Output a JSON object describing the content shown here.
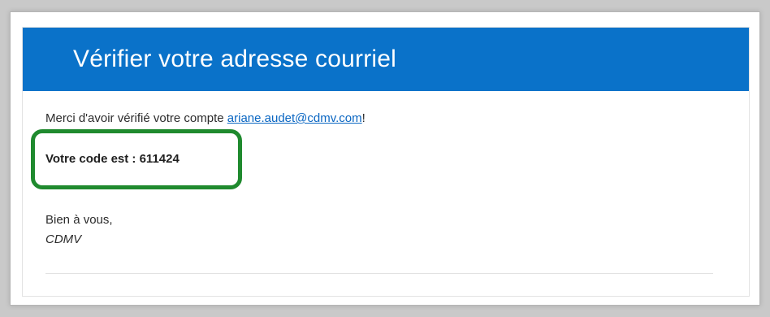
{
  "email": {
    "header_title": "Vérifier votre adresse courriel",
    "thanks_prefix": "Merci d'avoir vérifié votre compte ",
    "email_link": "ariane.audet@cdmv.com",
    "thanks_suffix": "!",
    "code_line": "Votre code est : 611424",
    "regards": "Bien à vous,",
    "signature": "CDMV"
  },
  "colors": {
    "header_blue": "#0a72c9",
    "highlight_green": "#1f8a2e",
    "link_blue": "#0a66c2"
  }
}
